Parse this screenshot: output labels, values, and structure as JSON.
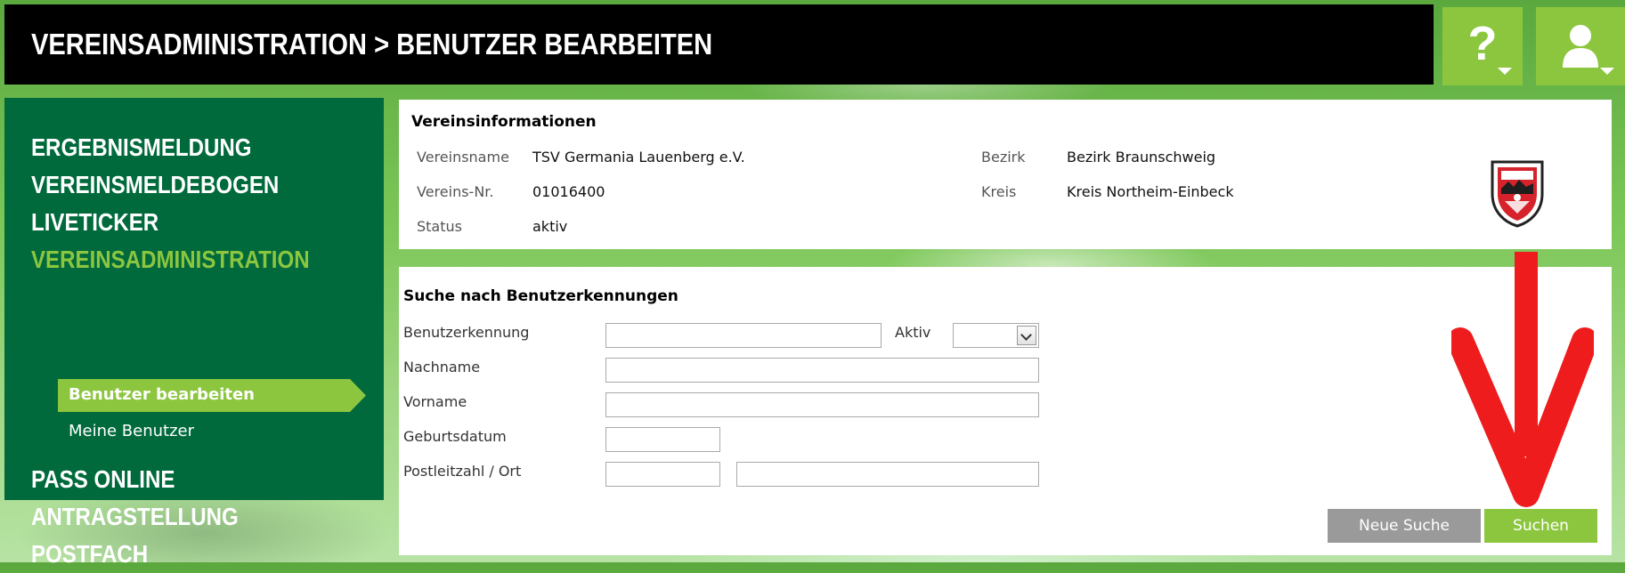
{
  "header": {
    "title": "VEREINSADMINISTRATION > BENUTZER BEARBEITEN",
    "help_label": "?",
    "brand_color": "#8cc63f"
  },
  "sidebar": {
    "top_items": [
      {
        "label": "ERGEBNISMELDUNG"
      },
      {
        "label": "VEREINSMELDEBOGEN"
      },
      {
        "label": "LIVETICKER"
      },
      {
        "label": "VEREINSADMINISTRATION",
        "current": true
      }
    ],
    "sub_items": [
      {
        "label": "Benutzer bearbeiten",
        "active": true
      },
      {
        "label": "Meine Benutzer"
      }
    ],
    "bottom_items": [
      {
        "label": "PASS ONLINE"
      },
      {
        "label": "ANTRAGSTELLUNG"
      },
      {
        "label": "POSTFACH"
      }
    ]
  },
  "club_info": {
    "title": "Vereinsinformationen",
    "name_label": "Vereinsname",
    "name_value": "TSV Germania Lauenberg e.V.",
    "number_label": "Vereins-Nr.",
    "number_value": "01016400",
    "status_label": "Status",
    "status_value": "aktiv",
    "district_label": "Bezirk",
    "district_value": "Bezirk Braunschweig",
    "county_label": "Kreis",
    "county_value": "Kreis Northeim-Einbeck",
    "logo_icon": "club-crest-icon"
  },
  "search": {
    "title": "Suche nach Benutzerkennungen",
    "fields": {
      "username_label": "Benutzerkennung",
      "username_value": "",
      "active_label": "Aktiv",
      "active_value": "",
      "lastname_label": "Nachname",
      "lastname_value": "",
      "firstname_label": "Vorname",
      "firstname_value": "",
      "birthdate_label": "Geburtsdatum",
      "birthdate_value": "",
      "zipcity_label": "Postleitzahl / Ort",
      "zip_value": "",
      "city_value": ""
    },
    "reset_button": "Neue Suche",
    "search_button": "Suchen"
  },
  "annotation": {
    "arrow_icon": "red-arrow-down-icon",
    "arrow_color": "#ee1c1c"
  }
}
